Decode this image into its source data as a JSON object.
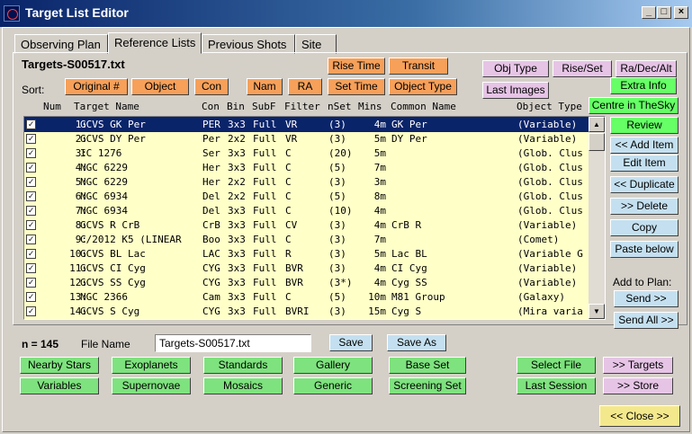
{
  "window": {
    "title": "Target List Editor"
  },
  "tabs": [
    "Observing Plan",
    "Reference Lists",
    "Previous Shots",
    "Site"
  ],
  "list_title": "Targets-S00517.txt",
  "sort_label": "Sort:",
  "sort_buttons": [
    "Original #",
    "Object",
    "Con",
    "Nam",
    "RA",
    "Set Time",
    "Object Type"
  ],
  "top_buttons": [
    "Rise Time",
    "Transit"
  ],
  "right_top_buttons": [
    "Obj Type",
    "Rise/Set",
    "Ra/Dec/Alt",
    "Last Images",
    "Extra Info",
    "Centre in TheSky"
  ],
  "columns": [
    "Num",
    "Target Name",
    "Con",
    "Bin",
    "SubF",
    "Filter",
    "nSet",
    "Mins",
    "Common Name",
    "Object Type"
  ],
  "rows": [
    {
      "num": "1:",
      "name": "GCVS GK Per",
      "con": "PER",
      "bin": "3x3",
      "subf": "Full",
      "filter": "VR",
      "nset": "(3)",
      "mins": "4m",
      "common": "GK Per",
      "type": "(Variable)"
    },
    {
      "num": "2:",
      "name": "GCVS DY Per",
      "con": "Per",
      "bin": "2x2",
      "subf": "Full",
      "filter": "VR",
      "nset": "(3)",
      "mins": "5m",
      "common": "DY Per",
      "type": "(Variable)"
    },
    {
      "num": "3:",
      "name": "IC 1276",
      "con": "Ser",
      "bin": "3x3",
      "subf": "Full",
      "filter": "C",
      "nset": "(20)",
      "mins": "5m",
      "common": "",
      "type": "(Glob. Clus"
    },
    {
      "num": "4:",
      "name": "NGC 6229",
      "con": "Her",
      "bin": "3x3",
      "subf": "Full",
      "filter": "C",
      "nset": "(5)",
      "mins": "7m",
      "common": "",
      "type": "(Glob. Clus"
    },
    {
      "num": "5:",
      "name": "NGC 6229",
      "con": "Her",
      "bin": "2x2",
      "subf": "Full",
      "filter": "C",
      "nset": "(3)",
      "mins": "3m",
      "common": "",
      "type": "(Glob. Clus"
    },
    {
      "num": "6:",
      "name": "NGC 6934",
      "con": "Del",
      "bin": "2x2",
      "subf": "Full",
      "filter": "C",
      "nset": "(5)",
      "mins": "8m",
      "common": "",
      "type": "(Glob. Clus"
    },
    {
      "num": "7:",
      "name": "NGC 6934",
      "con": "Del",
      "bin": "3x3",
      "subf": "Full",
      "filter": "C",
      "nset": "(10)",
      "mins": "4m",
      "common": "",
      "type": "(Glob. Clus"
    },
    {
      "num": "8:",
      "name": "GCVS R CrB",
      "con": "CrB",
      "bin": "3x3",
      "subf": "Full",
      "filter": "CV",
      "nset": "(3)",
      "mins": "4m",
      "common": "CrB R",
      "type": "(Variable)"
    },
    {
      "num": "9:",
      "name": "C/2012 K5 (LINEAR",
      "con": "Boo",
      "bin": "3x3",
      "subf": "Full",
      "filter": "C",
      "nset": "(3)",
      "mins": "7m",
      "common": "",
      "type": "(Comet)"
    },
    {
      "num": "10:",
      "name": "GCVS BL Lac",
      "con": "LAC",
      "bin": "3x3",
      "subf": "Full",
      "filter": "R",
      "nset": "(3)",
      "mins": "5m",
      "common": "Lac BL",
      "type": "(Variable G"
    },
    {
      "num": "11:",
      "name": "GCVS CI Cyg",
      "con": "CYG",
      "bin": "3x3",
      "subf": "Full",
      "filter": "BVR",
      "nset": "(3)",
      "mins": "4m",
      "common": "CI Cyg",
      "type": "(Variable)"
    },
    {
      "num": "12:",
      "name": "GCVS SS Cyg",
      "con": "CYG",
      "bin": "3x3",
      "subf": "Full",
      "filter": "BVR",
      "nset": "(3*)",
      "mins": "4m",
      "common": "Cyg SS",
      "type": "(Variable)"
    },
    {
      "num": "13:",
      "name": "NGC 2366",
      "con": "Cam",
      "bin": "3x3",
      "subf": "Full",
      "filter": "C",
      "nset": "(5)",
      "mins": "10m",
      "common": "M81 Group",
      "type": "(Galaxy)"
    },
    {
      "num": "14:",
      "name": "GCVS S Cyg",
      "con": "CYG",
      "bin": "3x3",
      "subf": "Full",
      "filter": "BVRI",
      "nset": "(3)",
      "mins": "15m",
      "common": "Cyg S",
      "type": "(Mira varia"
    }
  ],
  "side_buttons": [
    "Review",
    "<< Add Item",
    "Edit Item",
    "<< Duplicate",
    ">> Delete",
    "Copy",
    "Paste below"
  ],
  "add_to_plan_label": "Add to Plan:",
  "send_buttons": [
    "Send >>",
    "Send All >>"
  ],
  "count_label": "n = 145",
  "file_name_label": "File Name",
  "file_name_value": "Targets-S00517.txt",
  "save_buttons": [
    "Save",
    "Save As"
  ],
  "bottom_row1": [
    "Nearby Stars",
    "Exoplanets",
    "Standards",
    "Gallery",
    "Base Set"
  ],
  "bottom_row2": [
    "Variables",
    "Supernovae",
    "Mosaics",
    "Generic",
    "Screening Set"
  ],
  "session_buttons": [
    "Select File",
    "Last Session"
  ],
  "target_buttons": [
    ">> Targets",
    ">> Store"
  ],
  "close_button": "<< Close >>",
  "colors": {
    "titlebar": "#0a246a",
    "list_bg": "#ffffc8",
    "selection": "#0a246a",
    "orange": "#f6a05a",
    "pink": "#e6c4e6",
    "green": "#7fe07f",
    "blue": "#c4e0f0",
    "gold": "#f4e88c"
  }
}
